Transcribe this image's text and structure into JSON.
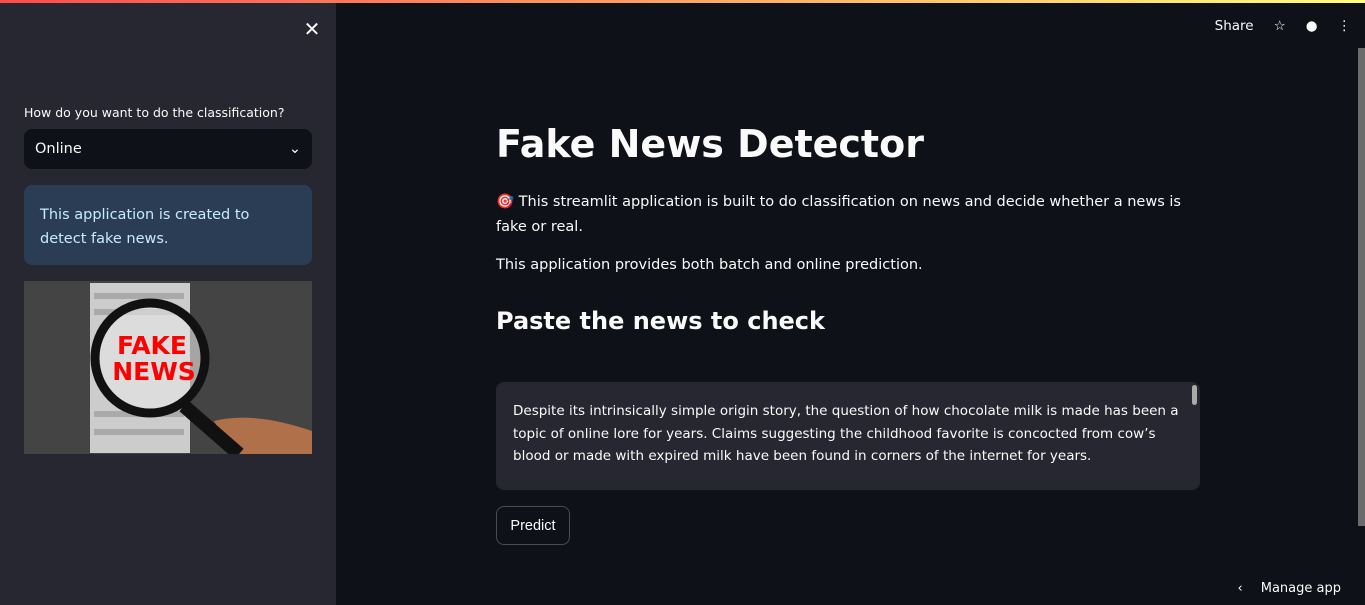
{
  "sidebar": {
    "close_icon": "close-icon",
    "select_label": "How do you want to do the classification?",
    "select_value": "Online",
    "info": "This application is created to detect fake news.",
    "image_text": "FAKE NEWS"
  },
  "header": {
    "share": "Share"
  },
  "main": {
    "title": "Fake News Detector",
    "emoji": "🎯",
    "intro": "This streamlit application is built to do classification on news and decide whether a news is fake or real.",
    "intro2": "This application provides both batch and online prediction.",
    "subtitle": "Paste the news to check",
    "textarea_value": "Despite its intrinsically simple origin story, the question of how chocolate milk is made has been a topic of online lore for years. Claims suggesting the childhood favorite is concocted from cow’s blood or made with expired milk have been found in corners of the internet for years.",
    "predict": "Predict"
  },
  "footer": {
    "manage": "Manage app"
  },
  "colors": {
    "accent_start": "#ff4b4b",
    "accent_end": "#fffd80",
    "info_bg": "#2b3d55"
  }
}
